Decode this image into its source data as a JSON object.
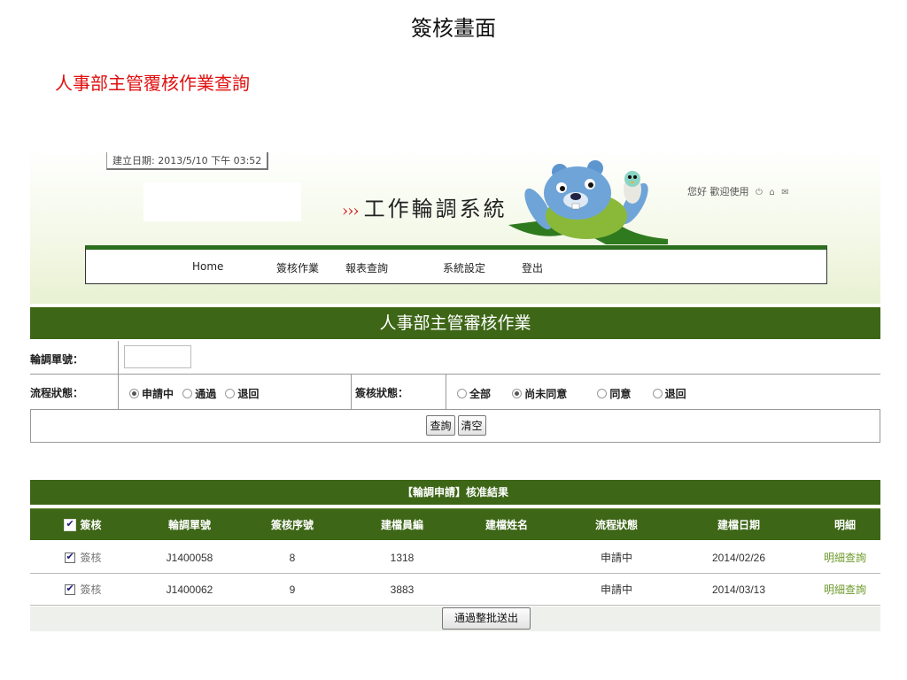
{
  "page": {
    "title": "簽核畫面",
    "section_title": "人事部主管覆核作業查詢"
  },
  "banner": {
    "created_date": "建立日期: 2013/5/10 下午 03:52",
    "system_title": "工作輪調系統",
    "chevrons": "›››",
    "welcome": "您好 歡迎使用",
    "welcome_icons": [
      "power-icon",
      "home-icon",
      "mail-icon"
    ],
    "accent": "#2c6f1e"
  },
  "nav": {
    "items": [
      "Home",
      "簽核作業",
      "報表查詢",
      "系統設定",
      "登出"
    ]
  },
  "form": {
    "header": "人事部主管審核作業",
    "rotation_no_label": "輪調單號：",
    "rotation_no_value": "",
    "flow_status_label": "流程狀態：",
    "flow_status_options": [
      "申請中",
      "通過",
      "退回"
    ],
    "flow_status_selected": "申請中",
    "sign_status_label": "簽核狀態：",
    "sign_status_options": [
      "全部",
      "尚未同意",
      "同意",
      "退回"
    ],
    "sign_status_selected": "尚未同意",
    "query_button": "查詢",
    "clear_button": "清空",
    "header_color": "#3d6616"
  },
  "results": {
    "header": "【輪調申請】核准結果",
    "columns": [
      "簽核",
      "輪調單號",
      "簽核序號",
      "建檔員編",
      "建檔姓名",
      "流程狀態",
      "建檔日期",
      "明細"
    ],
    "rows": [
      {
        "checked": true,
        "sign": "簽核",
        "rotation_no": "J1400058",
        "seq": "8",
        "emp_id": "1318",
        "name": "",
        "status": "申請中",
        "date": "2014/02/26",
        "detail": "明細查詢"
      },
      {
        "checked": true,
        "sign": "簽核",
        "rotation_no": "J1400062",
        "seq": "9",
        "emp_id": "3883",
        "name": "",
        "status": "申請中",
        "date": "2014/03/13",
        "detail": "明細查詢"
      }
    ],
    "submit_button": "通過整批送出"
  }
}
